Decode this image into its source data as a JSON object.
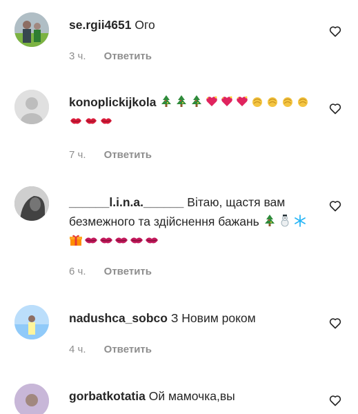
{
  "comments": [
    {
      "username": "se.rgii4651",
      "text": "Ого",
      "time": "3 ч.",
      "reply": "Ответить"
    },
    {
      "username": "konoplickijkola",
      "text": "",
      "emojis": [
        "tree",
        "tree",
        "tree",
        "heart",
        "heart",
        "heart",
        "clap",
        "clap",
        "clap",
        "clap",
        "kiss",
        "kiss",
        "kiss"
      ],
      "time": "7 ч.",
      "reply": "Ответить"
    },
    {
      "username": "______l.i.n.a.______",
      "text": "Вітаю, щастя вам безмежного та здійснення бажань",
      "emojis": [
        "tree",
        "snowman",
        "snowflake",
        "gift",
        "lips",
        "lips",
        "lips",
        "lips",
        "lips"
      ],
      "time": "6 ч.",
      "reply": "Ответить"
    },
    {
      "username": "nadushca_sobco",
      "text": "З Новим роком",
      "time": "4 ч.",
      "reply": "Ответить"
    },
    {
      "username": "gorbatkotatia",
      "text": "Ой мамочка,вы",
      "time": "",
      "reply": ""
    }
  ],
  "colors": {
    "text": "#262626",
    "meta": "#8e8e8e",
    "avatar_placeholder": "#dbdbdb"
  }
}
